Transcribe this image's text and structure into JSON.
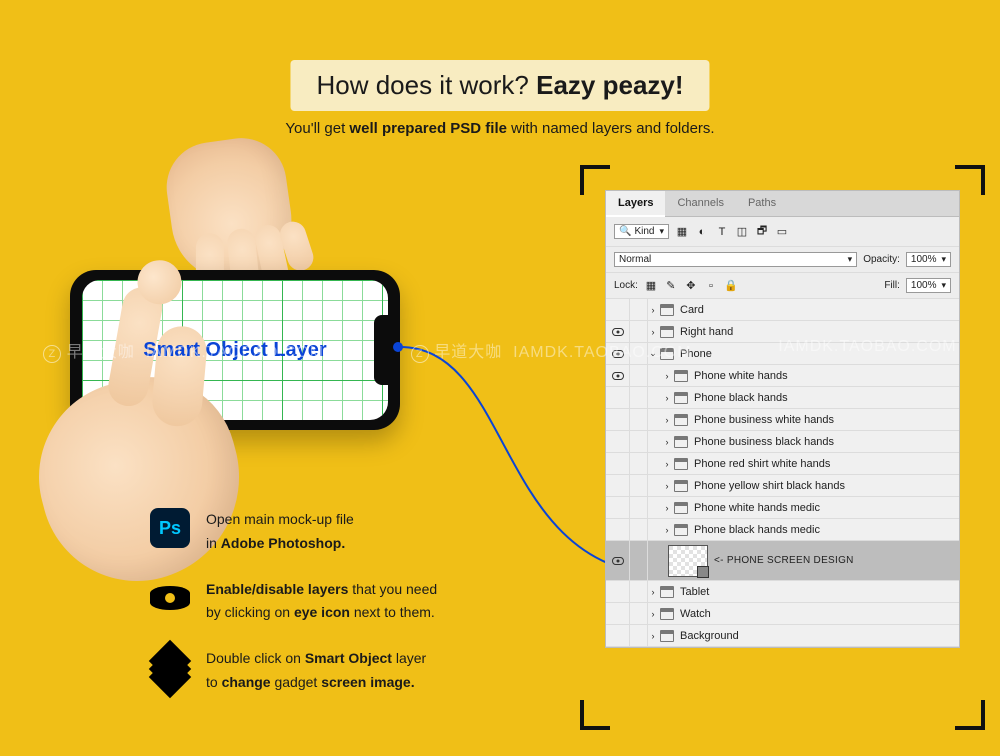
{
  "heading": {
    "prefix": "How does it work? ",
    "bold": "Eazy peazy!"
  },
  "subheading": {
    "part1": "You'll get ",
    "bold": "well prepared PSD file",
    "part2": " with named layers and folders."
  },
  "phone_screen_label": "Smart Object Layer",
  "instructions": [
    {
      "line1_a": "Open main mock-up file",
      "line2_a": "in ",
      "line2_bold": "Adobe Photoshop.",
      "line2_b": ""
    },
    {
      "line1_bold": "Enable/disable layers",
      "line1_b": " that you need",
      "line2_a": " by clicking on ",
      "line2_bold": "eye icon",
      "line2_b": " next to them."
    },
    {
      "line1_a": "Double click on ",
      "line1_bold": "Smart Object",
      "line1_b": " layer",
      "line2_a": "to ",
      "line2_bold": "change",
      "line2_mid": " gadget ",
      "line2_bold2": "screen image."
    }
  ],
  "panel": {
    "tabs": {
      "layers": "Layers",
      "channels": "Channels",
      "paths": "Paths"
    },
    "filter_label": "Kind",
    "blend_mode": "Normal",
    "opacity_label": "Opacity:",
    "opacity_value": "100%",
    "lock_label": "Lock:",
    "fill_label": "Fill:",
    "fill_value": "100%",
    "search_glyph": "🔍",
    "layers": [
      {
        "visible": false,
        "depth": 0,
        "arrow": "›",
        "name": "Card"
      },
      {
        "visible": true,
        "depth": 0,
        "arrow": "›",
        "name": "Right hand"
      },
      {
        "visible": true,
        "depth": 0,
        "arrow": "⌄",
        "name": "Phone"
      },
      {
        "visible": true,
        "depth": 1,
        "arrow": "›",
        "name": "Phone white hands"
      },
      {
        "visible": false,
        "depth": 1,
        "arrow": "›",
        "name": "Phone black hands"
      },
      {
        "visible": false,
        "depth": 1,
        "arrow": "›",
        "name": "Phone business white hands"
      },
      {
        "visible": false,
        "depth": 1,
        "arrow": "›",
        "name": "Phone business black hands"
      },
      {
        "visible": false,
        "depth": 1,
        "arrow": "›",
        "name": "Phone red shirt white hands"
      },
      {
        "visible": false,
        "depth": 1,
        "arrow": "›",
        "name": "Phone yellow shirt black hands"
      },
      {
        "visible": false,
        "depth": 1,
        "arrow": "›",
        "name": "Phone white hands medic"
      },
      {
        "visible": false,
        "depth": 1,
        "arrow": "›",
        "name": "Phone black hands medic"
      }
    ],
    "smart_layer_label": "<- PHONE SCREEN DESIGN",
    "tail_layers": [
      {
        "visible": false,
        "depth": 0,
        "arrow": "›",
        "name": "Tablet"
      },
      {
        "visible": false,
        "depth": 0,
        "arrow": "›",
        "name": "Watch"
      },
      {
        "visible": false,
        "depth": 0,
        "arrow": "›",
        "name": "Background"
      }
    ]
  },
  "watermark": {
    "badge": "Z",
    "text1": "早道大咖",
    "text2": "IAMDK.TAOBAO.COM"
  }
}
